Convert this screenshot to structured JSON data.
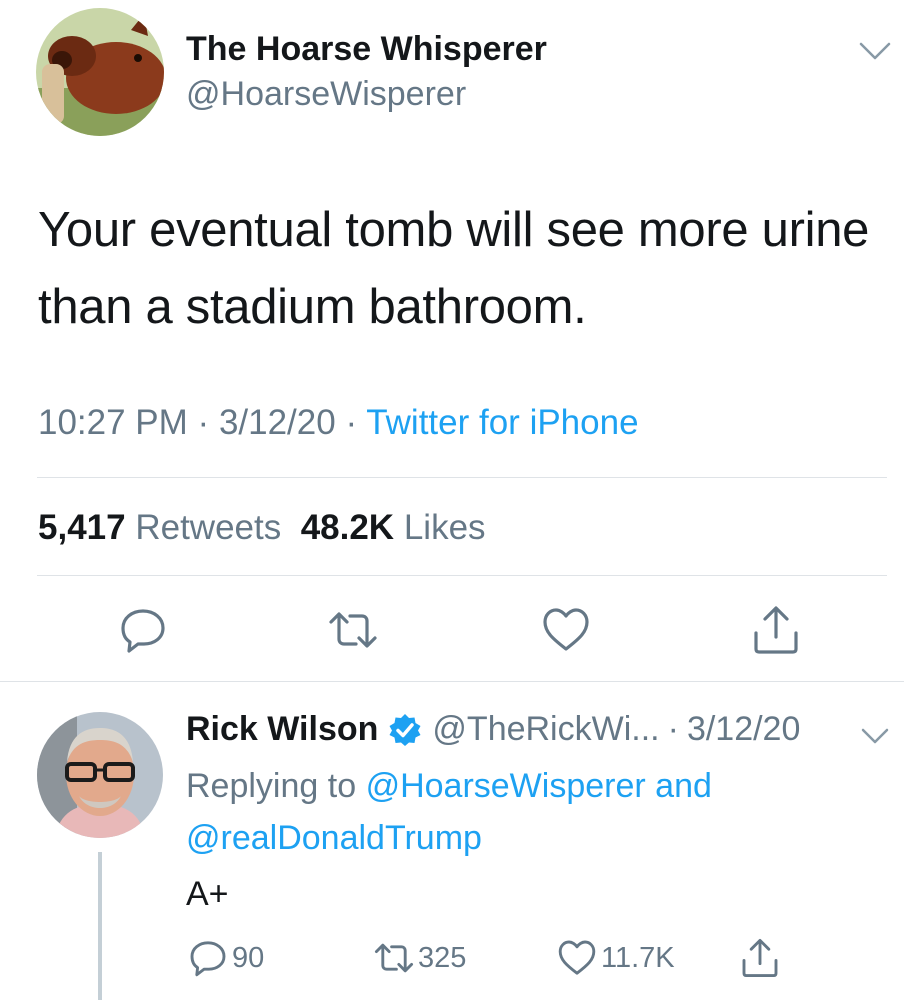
{
  "main_tweet": {
    "display_name": "The Hoarse Whisperer",
    "handle": "@HoarseWisperer",
    "text": "Your eventual tomb will see more urine than a stadium bathroom.",
    "time": "10:27 PM",
    "date": "3/12/20",
    "separator": "·",
    "source": "Twitter for iPhone",
    "retweets_count": "5,417",
    "retweets_label": "Retweets",
    "likes_count": "48.2K",
    "likes_label": "Likes"
  },
  "reply_tweet": {
    "display_name": "Rick Wilson",
    "handle": "@TheRickWi...",
    "separator": "·",
    "date": "3/12/20",
    "replying_prefix": "Replying to",
    "mention_1": "@HoarseWisperer",
    "and_word": "and",
    "mention_2": "@realDonaldTrump",
    "text": "A+",
    "reply_count": "90",
    "retweet_count": "325",
    "like_count": "11.7K"
  },
  "colors": {
    "text": "#14171a",
    "secondary": "#657786",
    "accent": "#1da1f2",
    "divider": "#dfe3e7",
    "icon": "#657786"
  },
  "icons": [
    "chevron-down-icon",
    "reply-icon",
    "retweet-icon",
    "like-icon",
    "share-icon",
    "verified-badge-icon"
  ]
}
